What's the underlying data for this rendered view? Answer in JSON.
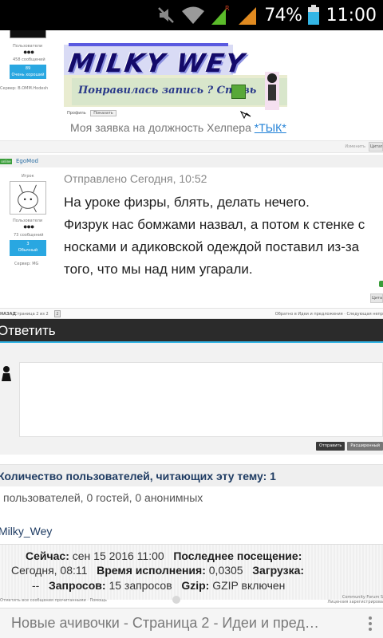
{
  "status_bar": {
    "battery_percent": "74%",
    "time": "11:00",
    "icons": [
      "mute-icon",
      "wifi-icon",
      "roaming-signal-icon",
      "signal-icon",
      "battery-icon"
    ]
  },
  "post1": {
    "group": "Пользователи",
    "reputation_count": "458 сообщений",
    "rep_value": "89",
    "rep_label": "Очень хороший",
    "server": "Сервер: B.OMM.Hodesh",
    "sig_title": "MILKY WEY",
    "sig_like": "Понравилась запись ? Ставь",
    "profile_label": "Профиль",
    "profile_button": "Показать",
    "link_line_text": "Моя заявка на должность Хелпера ",
    "link_text": "*ТЫК*",
    "edit_label": "Изменить",
    "quote_label": "Цитата"
  },
  "post2": {
    "online_badge": "online",
    "author": "EgoMod",
    "role": "Игрок",
    "group": "Пользователи",
    "count": "73 сообщений",
    "rep_value": "3",
    "rep_label": "Обычный",
    "server": "Сервер: MG",
    "date": "Отправлено Сегодня, 10:52",
    "lines": [
      "На уроке физры, блять, делать нечего.",
      "Физрук нас бомжами назвал, а потом к стенке с",
      "носками и адиковской одеждой поставил из-за",
      "того, что мы над ним угарали."
    ],
    "quote_label": "Цитата"
  },
  "pager": {
    "back": "НАЗАД",
    "pages": "Страница 2 из 2",
    "page": "2",
    "crumb": "Обратно в Идеи и предложения · Следующая непр"
  },
  "reply": {
    "title": "Ответить",
    "send": "Отправить",
    "extended": "Расширенный"
  },
  "readers": {
    "title": "Количество пользователей, читающих эту тему: 1",
    "line": "пользователей, 0 гостей, 0 анонимных",
    "name": "Milky_Wey"
  },
  "stats": {
    "now_label": "Сейчас:",
    "now_value": "сен 15 2016 11:00",
    "last_label": "Последнее посещение:",
    "last_value": "Сегодня, 08:11",
    "exec_label": "Время исполнения:",
    "exec_value": "0,0305",
    "load_label": "Загрузка:",
    "load_value": "--",
    "queries_label": "Запросов:",
    "queries_value": "15 запросов",
    "gzip_label": "Gzip:",
    "gzip_value": "GZIP включен"
  },
  "footer": {
    "left": "Отметить все сообщения прочитанными · Помощь",
    "right_1": "Community Forum S",
    "right_2": "Лицензия зарегистрирова"
  },
  "browser": {
    "title": "Новые ачивочки - Страница 2 - Идеи и предложения"
  }
}
